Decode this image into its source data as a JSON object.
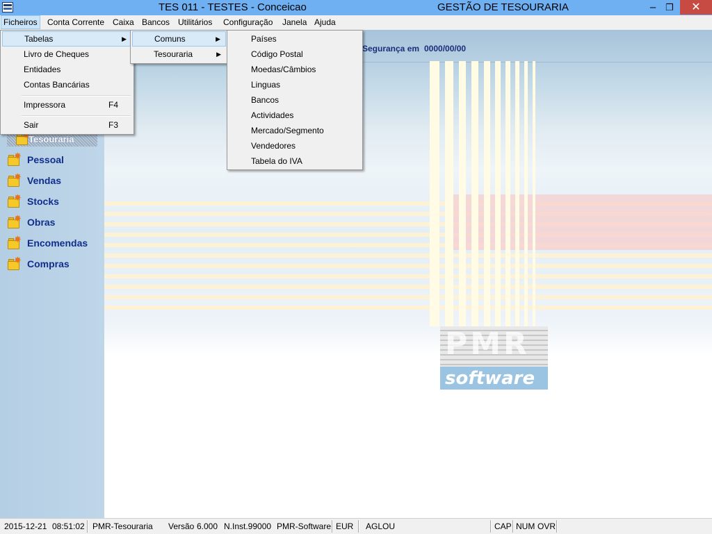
{
  "window": {
    "title": "TES 011 - TESTES - Conceicao",
    "app_title": "GESTÃO DE TESOURARIA",
    "controls": {
      "minimize": "–",
      "maximize": "❐",
      "close": "✕"
    }
  },
  "menubar": {
    "items": [
      "Ficheiros",
      "Conta Corrente",
      "Caixa",
      "Bancos",
      "Utilitários",
      "Configuração",
      "Janela",
      "Ajuda"
    ],
    "active": "Ficheiros"
  },
  "ficheiros_menu": {
    "items": [
      {
        "label": "Tabelas",
        "shortcut": "",
        "submenu": true
      },
      {
        "label": "Livro de Cheques",
        "shortcut": ""
      },
      {
        "label": "Entidades",
        "shortcut": ""
      },
      {
        "label": "Contas Bancárias",
        "shortcut": ""
      },
      {
        "label": "Impressora",
        "shortcut": "F4"
      },
      {
        "label": "Sair",
        "shortcut": "F3"
      }
    ],
    "highlighted": "Tabelas"
  },
  "tabelas_submenu": {
    "items": [
      {
        "label": "Comuns",
        "submenu": true
      },
      {
        "label": "Tesouraria",
        "submenu": true
      }
    ],
    "highlighted": "Comuns"
  },
  "comuns_submenu": {
    "items": [
      "Países",
      "Código Postal",
      "Moedas/Câmbios",
      "Linguas",
      "Bancos",
      "Actividades",
      "Mercado/Segmento",
      "Vendedores",
      "Tabela do IVA"
    ]
  },
  "header": {
    "security_label": "Segurança em",
    "security_value": "0000/00/00"
  },
  "sidebar": {
    "active_module": "Tesouraria",
    "modules": [
      "Pessoal",
      "Vendas",
      "Stocks",
      "Obras",
      "Encomendas",
      "Compras"
    ]
  },
  "logo": {
    "line1": "PMR",
    "line2": "software"
  },
  "statusbar": {
    "date": "2015-12-21",
    "time": "08:51:02",
    "app": "PMR-Tesouraria",
    "version_label": "Versão",
    "version": "6.000",
    "install": "N.Inst.99000",
    "company": "PMR-Software",
    "currency": "EUR",
    "user": "AGLOU",
    "cap": "CAP",
    "num": "NUM",
    "ovr": "OVR"
  },
  "colors": {
    "titlebar": "#6fb0f2",
    "sidebar": "#b4cee4",
    "module_text": "#102e8c",
    "menu_highlight": "#cce4f7"
  }
}
